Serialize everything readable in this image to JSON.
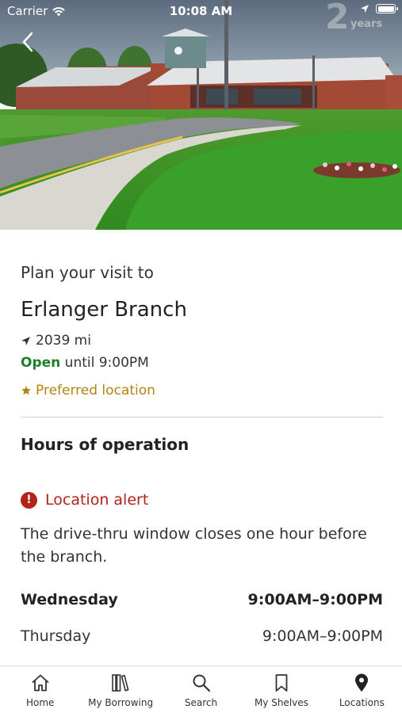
{
  "status_bar": {
    "carrier": "Carrier",
    "time": "10:08 AM"
  },
  "hero": {
    "watermark_number": "2",
    "watermark_text": "years"
  },
  "branch": {
    "plan_label": "Plan your visit to",
    "name": "Erlanger Branch",
    "distance": "2039 mi",
    "open_status": "Open",
    "open_until": "until 9:00PM",
    "preferred": "Preferred location"
  },
  "hours": {
    "heading": "Hours of operation",
    "alert_title": "Location alert",
    "alert_icon": "!",
    "alert_message": "The drive-thru window closes one hour before the branch.",
    "days": [
      {
        "day": "Wednesday",
        "hours": "9:00AM–9:00PM",
        "today": true
      },
      {
        "day": "Thursday",
        "hours": "9:00AM–9:00PM",
        "today": false
      }
    ]
  },
  "tabs": [
    {
      "label": "Home",
      "icon": "home-icon"
    },
    {
      "label": "My Borrowing",
      "icon": "books-icon"
    },
    {
      "label": "Search",
      "icon": "search-icon"
    },
    {
      "label": "My Shelves",
      "icon": "bookmark-icon"
    },
    {
      "label": "Locations",
      "icon": "location-pin-icon"
    }
  ],
  "colors": {
    "open_green": "#1d7f2a",
    "preferred_gold": "#b38410",
    "alert_red": "#b2231a"
  }
}
